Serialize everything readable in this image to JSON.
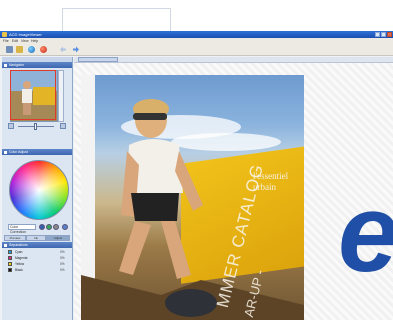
{
  "title_bar": {
    "app_title": "ACD ImageViewer",
    "icon": "app-icon",
    "controls": [
      "minimize-icon",
      "maximize-icon",
      "close-icon"
    ]
  },
  "menu": [
    "File",
    "Edit",
    "View",
    "Help"
  ],
  "toolbar": {
    "icons": [
      "save-icon",
      "open-icon",
      "globe-icon",
      "color-icon",
      "back-arrow-icon",
      "forward-arrow-icon"
    ]
  },
  "panels": {
    "navigator": {
      "title": "Navigator"
    },
    "color_adjust": {
      "title": "Color Adjust",
      "color_label": "Color Correction"
    },
    "separations": {
      "title": "Separations",
      "tabs": [
        "Preview",
        "Ink",
        "Adjust"
      ],
      "rows": [
        {
          "name": "Cyan",
          "value": "0%",
          "color": "#1fa3d8"
        },
        {
          "name": "Magenta",
          "value": "0%",
          "color": "#d8247a"
        },
        {
          "name": "Yellow",
          "value": "0%",
          "color": "#f2d21a"
        },
        {
          "name": "Black",
          "value": "0%",
          "color": "#111111"
        }
      ]
    }
  },
  "document": {
    "photo_text_line1": "l'essentiel",
    "photo_text_line2": "urbain",
    "catalog_text": "MMER CATALOG",
    "catalog_sub": "AR-UP -",
    "brand_letter": "e"
  },
  "colors": {
    "titlebar": "#2f72d6",
    "panel_header": "#3d67b2",
    "brand_blue": "#1f4fa6"
  }
}
